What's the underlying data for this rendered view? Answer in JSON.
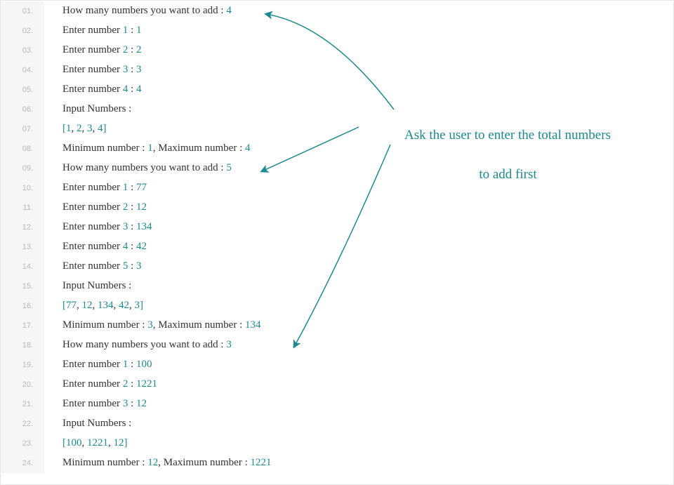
{
  "colors": {
    "number": "#1a8a8f",
    "text": "#333333",
    "gutter_bg": "#f6f6f6",
    "gutter_text": "#b8b8b8",
    "annotation": "#1a8a8f"
  },
  "annotation": {
    "line1": "Ask the user to enter the total numbers",
    "line2": "to add first"
  },
  "lines": [
    {
      "n": "01.",
      "tokens": [
        [
          "How many numbers you want to add : ",
          "txt"
        ],
        [
          "4",
          "num"
        ]
      ]
    },
    {
      "n": "02.",
      "tokens": [
        [
          "Enter number ",
          "txt"
        ],
        [
          "1",
          "num"
        ],
        [
          " : ",
          "txt"
        ],
        [
          "1",
          "num"
        ]
      ]
    },
    {
      "n": "03.",
      "tokens": [
        [
          "Enter number ",
          "txt"
        ],
        [
          "2",
          "num"
        ],
        [
          " : ",
          "txt"
        ],
        [
          "2",
          "num"
        ]
      ]
    },
    {
      "n": "04.",
      "tokens": [
        [
          "Enter number ",
          "txt"
        ],
        [
          "3",
          "num"
        ],
        [
          " : ",
          "txt"
        ],
        [
          "3",
          "num"
        ]
      ]
    },
    {
      "n": "05.",
      "tokens": [
        [
          "Enter number ",
          "txt"
        ],
        [
          "4",
          "num"
        ],
        [
          " : ",
          "txt"
        ],
        [
          "4",
          "num"
        ]
      ]
    },
    {
      "n": "06.",
      "tokens": [
        [
          "Input Numbers : ",
          "txt"
        ]
      ]
    },
    {
      "n": "07.",
      "tokens": [
        [
          "[",
          "num"
        ],
        [
          "1",
          "num"
        ],
        [
          ", ",
          "txt"
        ],
        [
          "2",
          "num"
        ],
        [
          ", ",
          "txt"
        ],
        [
          "3",
          "num"
        ],
        [
          ", ",
          "txt"
        ],
        [
          "4",
          "num"
        ],
        [
          "]",
          "num"
        ]
      ]
    },
    {
      "n": "08.",
      "tokens": [
        [
          "Minimum number : ",
          "txt"
        ],
        [
          "1",
          "num"
        ],
        [
          ", Maximum number : ",
          "txt"
        ],
        [
          "4",
          "num"
        ]
      ]
    },
    {
      "n": "09.",
      "tokens": [
        [
          "How many numbers you want to add : ",
          "txt"
        ],
        [
          "5",
          "num"
        ]
      ]
    },
    {
      "n": "10.",
      "tokens": [
        [
          "Enter number ",
          "txt"
        ],
        [
          "1",
          "num"
        ],
        [
          " : ",
          "txt"
        ],
        [
          "77",
          "num"
        ]
      ]
    },
    {
      "n": "11.",
      "tokens": [
        [
          "Enter number ",
          "txt"
        ],
        [
          "2",
          "num"
        ],
        [
          " : ",
          "txt"
        ],
        [
          "12",
          "num"
        ]
      ]
    },
    {
      "n": "12.",
      "tokens": [
        [
          "Enter number ",
          "txt"
        ],
        [
          "3",
          "num"
        ],
        [
          " : ",
          "txt"
        ],
        [
          "134",
          "num"
        ]
      ]
    },
    {
      "n": "13.",
      "tokens": [
        [
          "Enter number ",
          "txt"
        ],
        [
          "4",
          "num"
        ],
        [
          " : ",
          "txt"
        ],
        [
          "42",
          "num"
        ]
      ]
    },
    {
      "n": "14.",
      "tokens": [
        [
          "Enter number ",
          "txt"
        ],
        [
          "5",
          "num"
        ],
        [
          " : ",
          "txt"
        ],
        [
          "3",
          "num"
        ]
      ]
    },
    {
      "n": "15.",
      "tokens": [
        [
          "Input Numbers : ",
          "txt"
        ]
      ]
    },
    {
      "n": "16.",
      "tokens": [
        [
          "[",
          "num"
        ],
        [
          "77",
          "num"
        ],
        [
          ", ",
          "txt"
        ],
        [
          "12",
          "num"
        ],
        [
          ", ",
          "txt"
        ],
        [
          "134",
          "num"
        ],
        [
          ", ",
          "txt"
        ],
        [
          "42",
          "num"
        ],
        [
          ", ",
          "txt"
        ],
        [
          "3",
          "num"
        ],
        [
          "]",
          "num"
        ]
      ]
    },
    {
      "n": "17.",
      "tokens": [
        [
          "Minimum number : ",
          "txt"
        ],
        [
          "3",
          "num"
        ],
        [
          ", Maximum number : ",
          "txt"
        ],
        [
          "134",
          "num"
        ]
      ]
    },
    {
      "n": "18.",
      "tokens": [
        [
          "How many numbers you want to add : ",
          "txt"
        ],
        [
          "3",
          "num"
        ]
      ]
    },
    {
      "n": "19.",
      "tokens": [
        [
          "Enter number ",
          "txt"
        ],
        [
          "1",
          "num"
        ],
        [
          " : ",
          "txt"
        ],
        [
          "100",
          "num"
        ]
      ]
    },
    {
      "n": "20.",
      "tokens": [
        [
          "Enter number ",
          "txt"
        ],
        [
          "2",
          "num"
        ],
        [
          " : ",
          "txt"
        ],
        [
          "1221",
          "num"
        ]
      ]
    },
    {
      "n": "21.",
      "tokens": [
        [
          "Enter number ",
          "txt"
        ],
        [
          "3",
          "num"
        ],
        [
          " : ",
          "txt"
        ],
        [
          "12",
          "num"
        ]
      ]
    },
    {
      "n": "22.",
      "tokens": [
        [
          "Input Numbers : ",
          "txt"
        ]
      ]
    },
    {
      "n": "23.",
      "tokens": [
        [
          "[",
          "num"
        ],
        [
          "100",
          "num"
        ],
        [
          ", ",
          "txt"
        ],
        [
          "1221",
          "num"
        ],
        [
          ", ",
          "txt"
        ],
        [
          "12",
          "num"
        ],
        [
          "]",
          "num"
        ]
      ]
    },
    {
      "n": "24.",
      "tokens": [
        [
          "Minimum number : ",
          "txt"
        ],
        [
          "12",
          "num"
        ],
        [
          ", Maximum number : ",
          "txt"
        ],
        [
          "1221",
          "num"
        ]
      ]
    }
  ]
}
